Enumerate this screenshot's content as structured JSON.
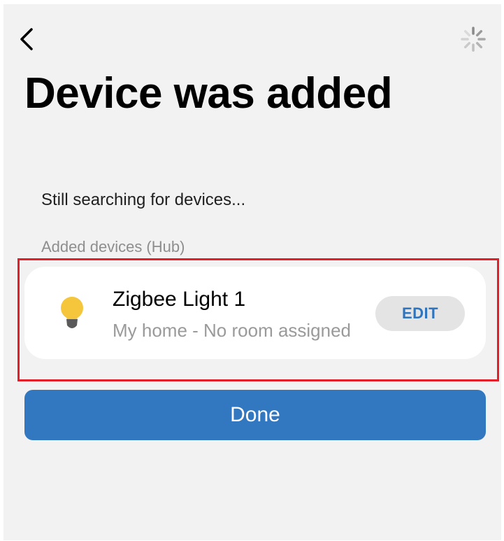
{
  "header": {
    "back_icon": "chevron-left-icon",
    "loading_icon": "loading-spinner-icon"
  },
  "page": {
    "title": "Device was added",
    "status_text": "Still searching for devices...",
    "section_label": "Added devices (Hub)"
  },
  "devices": [
    {
      "name": "Zigbee Light 1",
      "location": "My home - No room assigned",
      "icon": "light-bulb-icon",
      "edit_label": "EDIT"
    }
  ],
  "actions": {
    "done_label": "Done"
  },
  "colors": {
    "background": "#f2f2f2",
    "card": "#ffffff",
    "accent": "#3178c0",
    "edit_text": "#2f75be",
    "bulb": "#f5c53c",
    "highlight": "#e3202a"
  }
}
